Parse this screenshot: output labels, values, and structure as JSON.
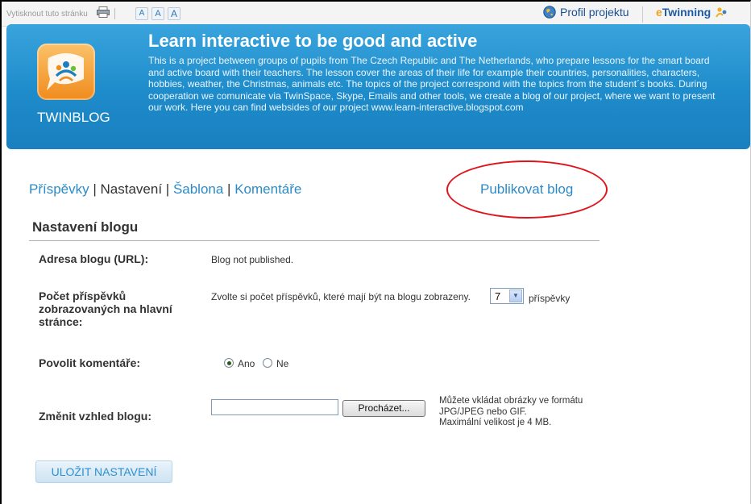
{
  "topbar": {
    "print_link": "Vytisknout tuto stránku",
    "font_sizes": [
      "A",
      "A",
      "A"
    ],
    "project_profile": "Profil projektu",
    "etwinning_e": "e",
    "etwinning_rest": "Twinning"
  },
  "header": {
    "logo_text": "TWINBLOG",
    "title": "Learn interactive to be good and active",
    "description": "This is a project between groups of pupils from The Czech Republic and The Netherlands, who prepare lessons for the smart board and active board with their teachers. The lesson cover the areas of their life for example their countries, personalities, characters, hobbies, weather, the Christmas, animals etc. The topics of the project correspond with the topics from the student´s books. During cooperation we comunicate via TwinSpace, Skype, Emails and other tools, we create a blog of our project, where we want to present our work. Here you can find websides of our project www.learn-interactive.blogspot.com"
  },
  "nav": {
    "posts": "Příspěvky",
    "settings": "Nastavení",
    "template": "Šablona",
    "comments": "Komentáře",
    "separator": " | ",
    "publish": "Publikovat blog"
  },
  "settings": {
    "title": "Nastavení blogu",
    "url_label": "Adresa blogu (URL):",
    "url_value": "Blog not published.",
    "posts_count_label_1": "Počet příspěvků",
    "posts_count_label_2": "zobrazovaných na hlavní",
    "posts_count_label_3": "stránce:",
    "posts_count_text": "Zvolte si počet příspěvků, které mají být na blogu zobrazeny.",
    "posts_count_value": "7",
    "posts_count_unit": "příspěvky",
    "comments_label": "Povolit komentáře:",
    "comments_yes": "Ano",
    "comments_no": "Ne",
    "comments_selected": "Ano",
    "appearance_label": "Změnit vzhled blogu:",
    "browse_button": "Procházet...",
    "file_value": "",
    "hint_1": "Můžete vkládat obrázky ve formátu",
    "hint_2": "JPG/JPEG nebo GIF.",
    "hint_3": "Maximální velikost je 4 MB.",
    "save_button": "ULOŽIT NASTAVENÍ"
  },
  "icons": {
    "print": "printer-icon",
    "globe": "globe-icon",
    "etwinning_logo": "etwinning-logo-icon",
    "logo": "twinblog-logo-icon"
  },
  "colors": {
    "header_blue": "#1e8bca",
    "link_blue": "#2b8bc8",
    "highlight_red": "#e0141b"
  }
}
